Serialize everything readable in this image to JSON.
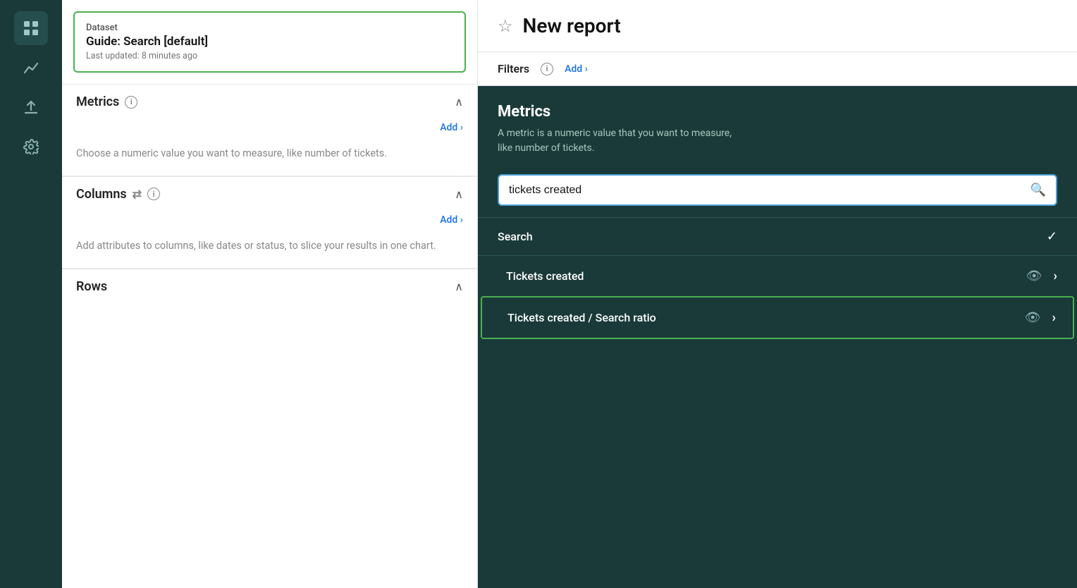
{
  "sidebar": {
    "icons": [
      {
        "name": "grid-icon",
        "symbol": "⊞",
        "active": true
      },
      {
        "name": "chart-icon",
        "symbol": "📈",
        "active": false
      },
      {
        "name": "upload-icon",
        "symbol": "⬆",
        "active": false
      },
      {
        "name": "settings-icon",
        "symbol": "⚙",
        "active": false
      }
    ]
  },
  "left_panel": {
    "dataset": {
      "label": "Dataset",
      "name": "Guide: Search [default]",
      "updated": "Last updated: 8 minutes ago"
    },
    "metrics_section": {
      "title": "Metrics",
      "add_label": "Add ›",
      "description": "Choose a numeric value you want to measure, like number of tickets."
    },
    "columns_section": {
      "title": "Columns",
      "add_label": "Add ›",
      "description": "Add attributes to columns, like dates or status, to slice your results in one chart."
    },
    "rows_section": {
      "title": "Rows"
    }
  },
  "right_panel": {
    "header": {
      "title": "New report",
      "star_label": "☆"
    },
    "filters": {
      "label": "Filters",
      "add_label": "Add ›"
    },
    "metrics_panel": {
      "title": "Metrics",
      "description": "A metric is a numeric value that you want to measure,\nlike number of tickets.",
      "search_placeholder": "tickets created",
      "search_value": "tickets created",
      "dropdown_section_label": "Search",
      "result_items": [
        {
          "label": "Tickets created",
          "selected": false
        },
        {
          "label": "Tickets created / Search ratio",
          "selected": true
        }
      ]
    }
  }
}
